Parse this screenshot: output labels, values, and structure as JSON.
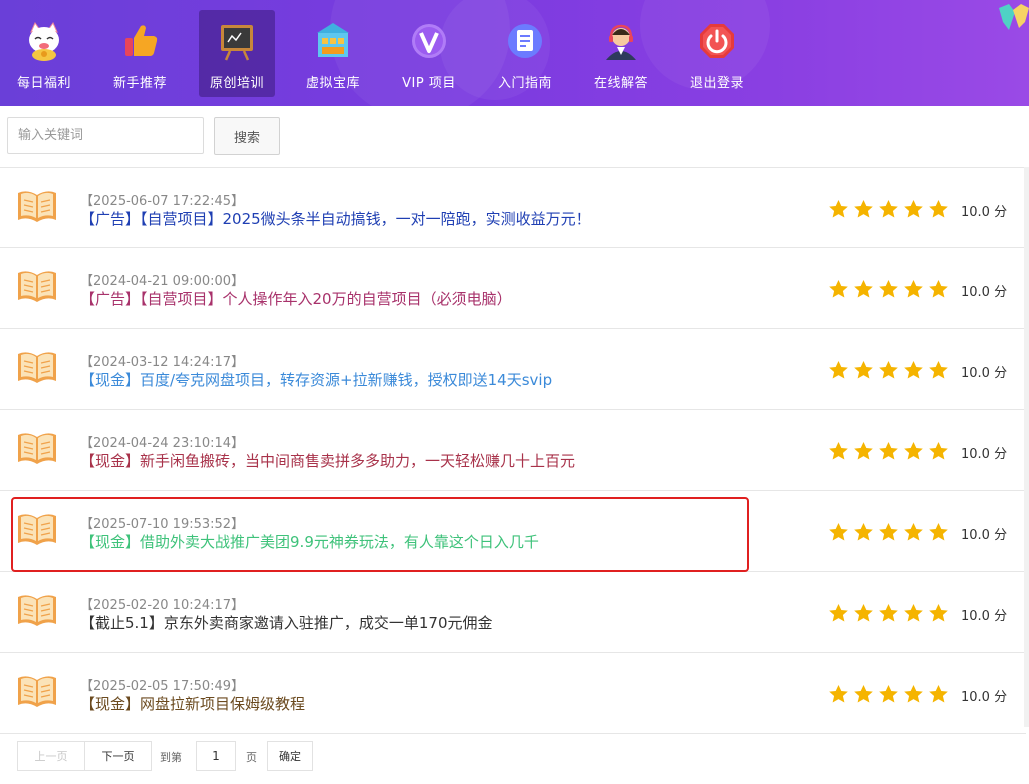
{
  "nav": {
    "items": [
      {
        "label": "每日福利",
        "icon": "lucky-cat-icon"
      },
      {
        "label": "新手推荐",
        "icon": "thumbs-up-icon"
      },
      {
        "label": "原创培训",
        "icon": "chalkboard-icon",
        "active": true
      },
      {
        "label": "虚拟宝库",
        "icon": "treasure-building-icon"
      },
      {
        "label": "VIP 项目",
        "icon": "vip-icon"
      },
      {
        "label": "入门指南",
        "icon": "document-icon"
      },
      {
        "label": "在线解答",
        "icon": "support-agent-icon"
      },
      {
        "label": "退出登录",
        "icon": "power-icon"
      }
    ]
  },
  "search": {
    "placeholder": "输入关键词",
    "value": "",
    "button_label": "搜索"
  },
  "list": {
    "items": [
      {
        "date": "【2025-06-07 17:22:45】",
        "title": "【广告】【自营项目】2025微头条半自动搞钱，一对一陪跑，实测收益万元！",
        "color": "#1f3fb3",
        "rating": 5,
        "score": "10.0 分"
      },
      {
        "date": "【2024-04-21 09:00:00】",
        "title": "【广告】【自营项目】个人操作年入20万的自营项目（必须电脑）",
        "color": "#a8326b",
        "rating": 5,
        "score": "10.0 分"
      },
      {
        "date": "【2024-03-12 14:24:17】",
        "title": "【现金】百度/夸克网盘项目，转存资源+拉新赚钱，授权即送14天svip",
        "color": "#3b8ad9",
        "rating": 5,
        "score": "10.0 分"
      },
      {
        "date": "【2024-04-24 23:10:14】",
        "title": "【现金】新手闲鱼搬砖，当中间商售卖拼多多助力，一天轻松赚几十上百元",
        "color": "#a8324a",
        "rating": 5,
        "score": "10.0 分"
      },
      {
        "date": "【2025-07-10 19:53:52】",
        "title": "【现金】借助外卖大战推广美团9.9元神券玩法，有人靠这个日入几千",
        "color": "#3ec27a",
        "rating": 5,
        "score": "10.0 分"
      },
      {
        "date": "【2025-02-20 10:24:17】",
        "title": "【截止5.1】京东外卖商家邀请入驻推广，成交一单170元佣金",
        "color": "#333333",
        "rating": 5,
        "score": "10.0 分"
      },
      {
        "date": "【2025-02-05 17:50:49】",
        "title": "【现金】网盘拉新项目保姆级教程",
        "color": "#6b4a1f",
        "rating": 5,
        "score": "10.0 分"
      }
    ]
  },
  "pager": {
    "prev_label": "上一页",
    "next_label": "下一页",
    "goto_prefix": "到第",
    "page_value": "1",
    "goto_suffix": "页",
    "confirm_label": "确定"
  },
  "colors": {
    "nav_gradient_start": "#6a3fd8",
    "nav_gradient_end": "#9a4ae6",
    "star": "#f5b400",
    "highlight": "#e02020"
  }
}
